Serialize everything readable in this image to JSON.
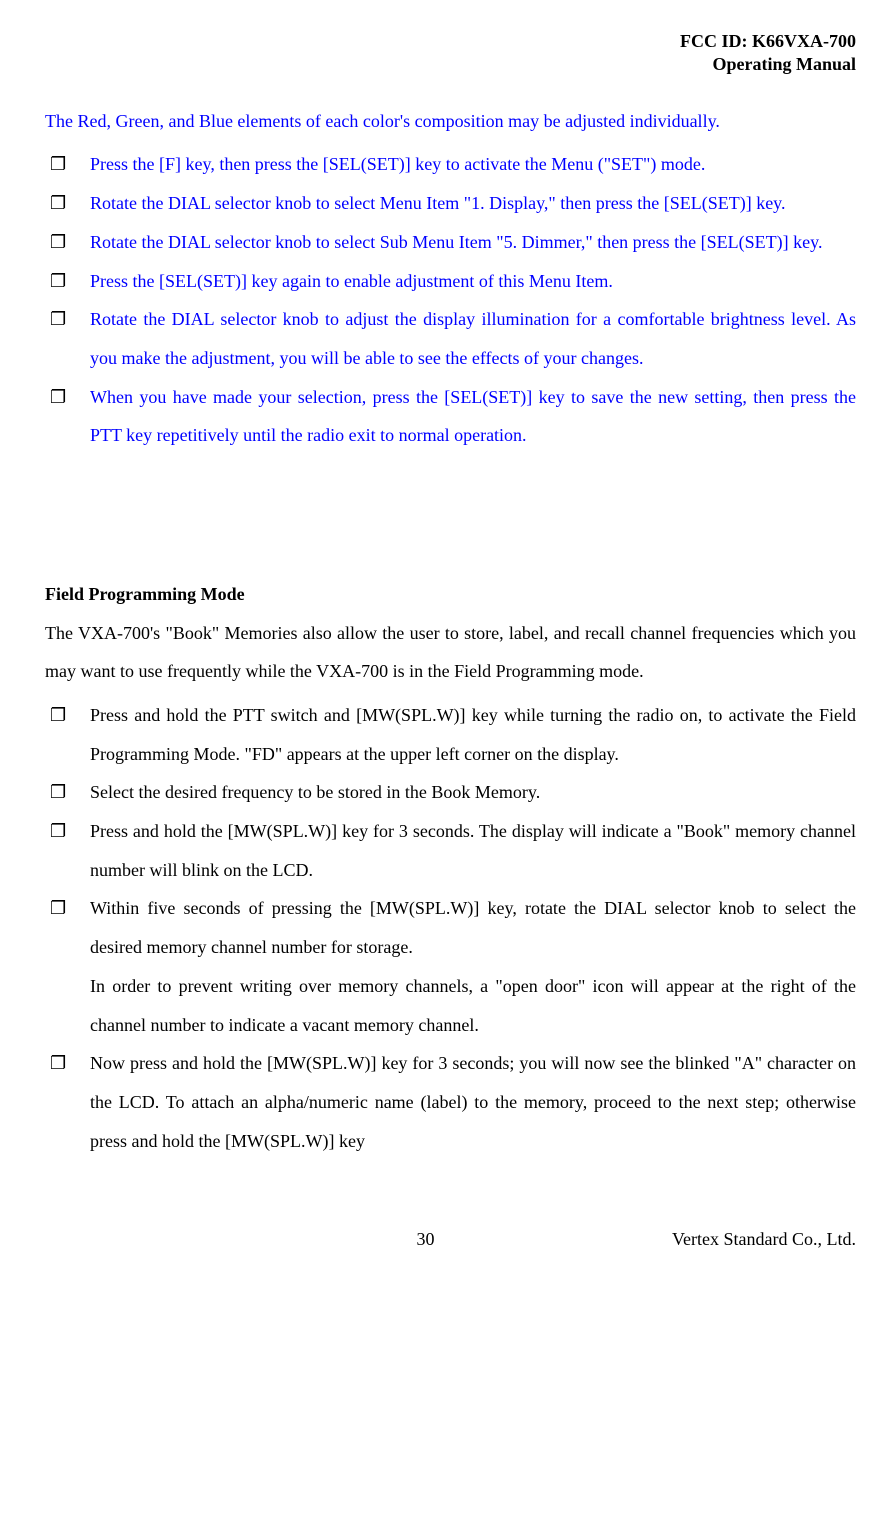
{
  "header": {
    "fcc_id": "FCC ID: K66VXA-700",
    "doc_title": "Operating Manual"
  },
  "intro_blue": "The Red, Green, and Blue elements of each color's composition may be adjusted individually.",
  "blue_list": [
    "Press the [F] key, then press the [SEL(SET)] key to activate the Menu (\"SET\") mode.",
    "Rotate the DIAL selector knob to select Menu Item \"1. Display,\" then press the [SEL(SET)] key.",
    "Rotate the DIAL selector knob to select Sub Menu Item \"5. Dimmer,\" then press the [SEL(SET)] key.",
    "Press the [SEL(SET)] key again to enable adjustment of this Menu Item.",
    "Rotate the DIAL selector knob to adjust the display illumination for a comfortable brightness level. As you make the adjustment, you will be able to see the effects of your changes.",
    "When you have made your selection, press the [SEL(SET)] key to save the new setting, then press the PTT key repetitively until the radio exit to normal operation."
  ],
  "section_heading": "Field Programming Mode",
  "intro_black": "The VXA-700's \"Book\" Memories also allow the user to store, label, and recall channel frequencies which you may want to use frequently while the VXA-700 is in the Field Programming mode.",
  "black_list": [
    {
      "text": "Press and hold the PTT switch and [MW(SPL.W)] key while turning the radio on, to activate the Field Programming Mode. \"FD\" appears at the upper left corner on the display."
    },
    {
      "text": "Select the desired frequency to be stored in the Book Memory."
    },
    {
      "text": "Press and hold the [MW(SPL.W)] key for 3 seconds. The display will indicate a \"Book\" memory channel number will blink on the LCD."
    },
    {
      "text": "Within five seconds of pressing the [MW(SPL.W)] key, rotate the DIAL selector knob to select the desired memory channel number for storage.",
      "continuation": "In order to prevent writing over memory channels, a \"open door\" icon will appear at the right of the channel number to indicate a vacant memory channel."
    },
    {
      "text": "Now press and hold the [MW(SPL.W)] key for 3 seconds; you will now see the blinked \"A\" character on the LCD. To attach an alpha/numeric name (label) to the memory, proceed to the next step; otherwise press and hold the [MW(SPL.W)] key"
    }
  ],
  "footer": {
    "page_number": "30",
    "company": "Vertex Standard Co., Ltd."
  },
  "checkbox_symbol": "❐"
}
